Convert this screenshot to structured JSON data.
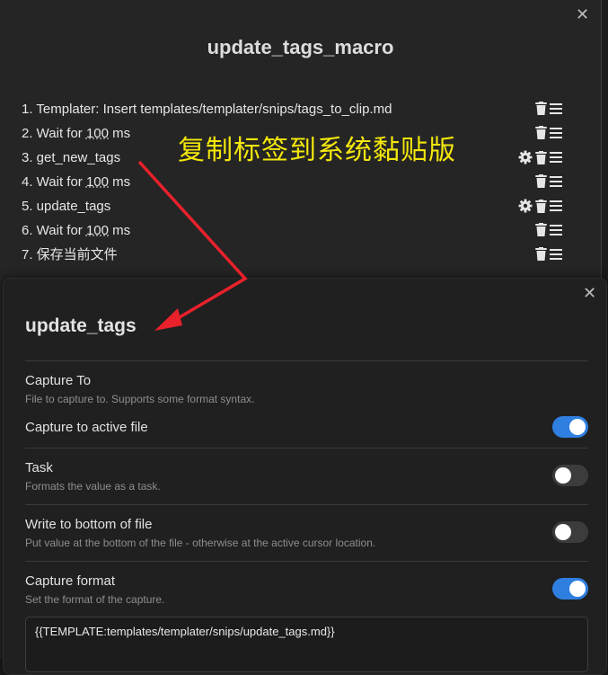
{
  "macro": {
    "title": "update_tags_macro",
    "commands": [
      {
        "prefix": "1. Templater: Insert templates/templater/snips/tags_to_clip.md",
        "number": "",
        "suffix": "",
        "has_gear": false
      },
      {
        "prefix": "2. Wait for ",
        "number": "100",
        "suffix": " ms",
        "has_gear": false
      },
      {
        "prefix": "3. get_new_tags",
        "number": "",
        "suffix": "",
        "has_gear": true
      },
      {
        "prefix": "4. Wait for ",
        "number": "100",
        "suffix": " ms",
        "has_gear": false
      },
      {
        "prefix": "5. update_tags",
        "number": "",
        "suffix": "",
        "has_gear": true
      },
      {
        "prefix": "6. Wait for ",
        "number": "100",
        "suffix": " ms",
        "has_gear": false
      },
      {
        "prefix": "7. 保存当前文件",
        "number": "",
        "suffix": "",
        "has_gear": false
      }
    ],
    "close_symbol": "✕"
  },
  "annotation": {
    "text": "复制标签到系统黏贴版",
    "color": "#f3e70c",
    "arrow_color": "#e8212b"
  },
  "capture": {
    "title": "update_tags",
    "close_symbol": "✕",
    "capture_to_label": "Capture To",
    "capture_to_desc": "File to capture to. Supports some format syntax.",
    "active_file_label": "Capture to active file",
    "active_file_on": true,
    "task_label": "Task",
    "task_desc": "Formats the value as a task.",
    "task_on": false,
    "bottom_label": "Write to bottom of file",
    "bottom_desc": "Put value at the bottom of the file - otherwise at the active cursor location.",
    "bottom_on": false,
    "format_label": "Capture format",
    "format_desc": "Set the format of the capture.",
    "format_on": true,
    "format_value": "{{TEMPLATE:templates/templater/snips/update_tags.md}}"
  },
  "colors": {
    "toggle_on": "#2f7fe0",
    "toggle_off": "#3c3c3c"
  }
}
